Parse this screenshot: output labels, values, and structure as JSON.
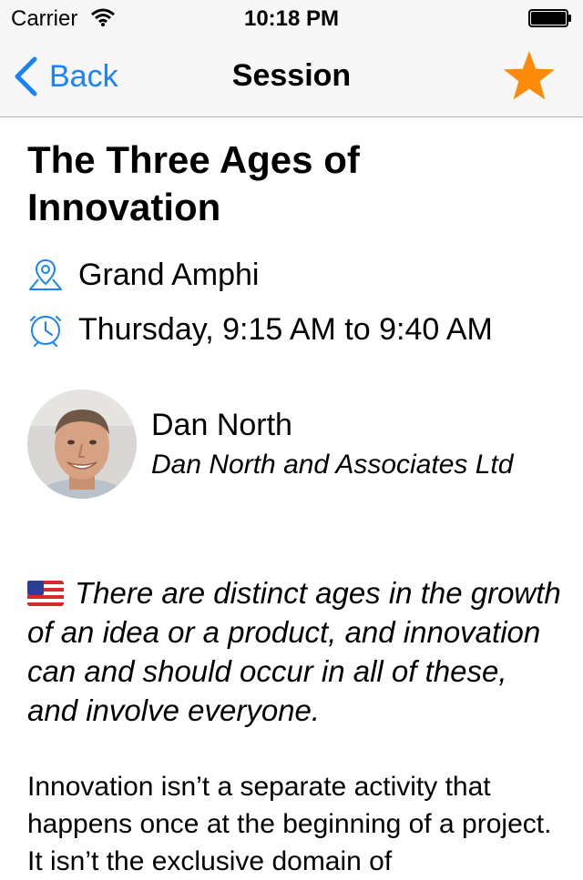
{
  "status_bar": {
    "carrier": "Carrier",
    "time": "10:18 PM"
  },
  "nav": {
    "back_label": "Back",
    "title": "Session",
    "favorite_icon": "star-icon"
  },
  "session": {
    "title": "The Three Ages of Innovation",
    "room": "Grand Amphi",
    "time": "Thursday, 9:15 AM to 9:40 AM",
    "language_flag": "us-flag-icon",
    "summary": "There are distinct ages in the growth of an idea or a product, and innovation can and should occur in all of these, and involve everyone.",
    "description": "Innovation isn’t a separate activity that happens once at the beginning of a project. It isn’t the exclusive domain of"
  },
  "speaker": {
    "name": "Dan North",
    "company": "Dan North and Associates Ltd"
  },
  "colors": {
    "accent": "#1a82fb",
    "favorite": "#fd8a09",
    "nav_background": "#f7f7f7"
  }
}
